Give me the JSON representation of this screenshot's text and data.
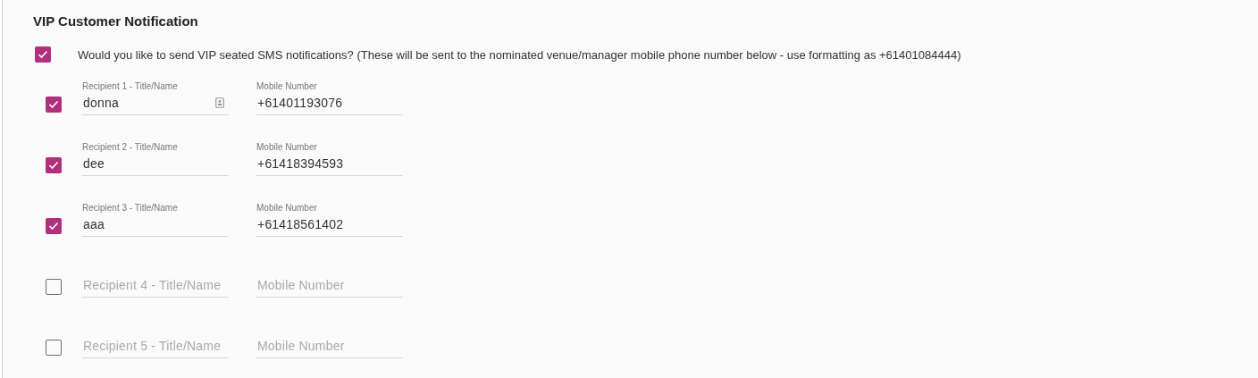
{
  "title": "VIP Customer Notification",
  "send_sms": {
    "checked": true,
    "label": "Would you like to send VIP seated SMS notifications? (These will be sent to the nominated venue/manager mobile phone number below - use formatting as +61401084444)"
  },
  "recipients": [
    {
      "checked": true,
      "name": {
        "label": "Recipient 1 - Title/Name",
        "value": "donna",
        "contact_icon": true
      },
      "mobile": {
        "label": "Mobile Number",
        "value": "+61401193076"
      }
    },
    {
      "checked": true,
      "name": {
        "label": "Recipient 2 - Title/Name",
        "value": "dee",
        "contact_icon": false
      },
      "mobile": {
        "label": "Mobile Number",
        "value": "+61418394593"
      }
    },
    {
      "checked": true,
      "name": {
        "label": "Recipient 3 - Title/Name",
        "value": "aaa",
        "contact_icon": false
      },
      "mobile": {
        "label": "Mobile Number",
        "value": "+61418561402"
      }
    },
    {
      "checked": false,
      "name": {
        "placeholder": "Recipient 4 - Title/Name",
        "contact_icon": false
      },
      "mobile": {
        "placeholder": "Mobile Number"
      }
    },
    {
      "checked": false,
      "name": {
        "placeholder": "Recipient 5 - Title/Name",
        "contact_icon": false
      },
      "mobile": {
        "placeholder": "Mobile Number"
      }
    }
  ]
}
